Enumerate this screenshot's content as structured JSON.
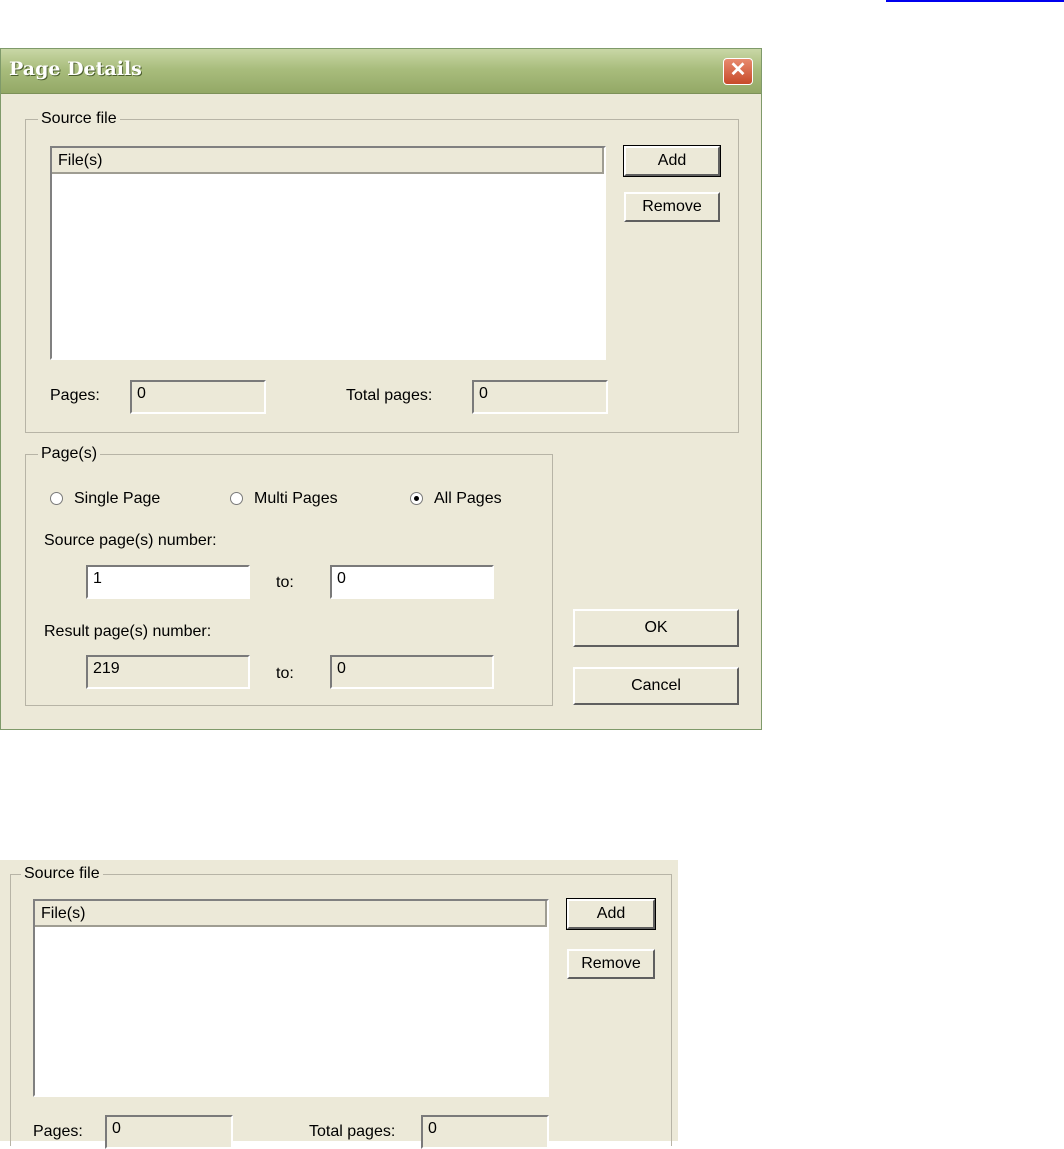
{
  "dialog": {
    "title": "Page Details",
    "close_icon": "close-icon",
    "source_file": {
      "legend": "Source file",
      "list_header": "File(s)",
      "add_label": "Add",
      "remove_label": "Remove",
      "pages_label": "Pages:",
      "pages_value": "0",
      "total_pages_label": "Total pages:",
      "total_pages_value": "0"
    },
    "pages": {
      "legend": "Page(s)",
      "radio_single": "Single Page",
      "radio_multi": "Multi Pages",
      "radio_all": "All Pages",
      "selected": "All Pages",
      "source_label": "Source page(s) number:",
      "source_from": "1",
      "source_to": "0",
      "result_label": "Result page(s) number:",
      "result_from": "219",
      "result_to": "0",
      "to_label": "to:"
    },
    "ok_label": "OK",
    "cancel_label": "Cancel"
  },
  "panel2": {
    "legend": "Source file",
    "list_header": "File(s)",
    "add_label": "Add",
    "remove_label": "Remove",
    "pages_label": "Pages:",
    "pages_value": "0",
    "total_pages_label": "Total pages:",
    "total_pages_value": "0"
  }
}
